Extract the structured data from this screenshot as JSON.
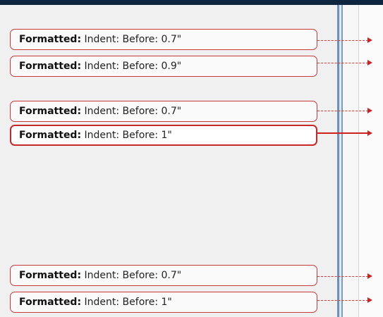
{
  "comments": [
    {
      "label": "Formatted:",
      "detail": " Indent: Before:  0.7\"",
      "selected": false
    },
    {
      "label": "Formatted:",
      "detail": " Indent: Before:  0.9\"",
      "selected": false
    },
    {
      "label": "Formatted:",
      "detail": " Indent: Before:  0.7\"",
      "selected": false
    },
    {
      "label": "Formatted:",
      "detail": " Indent: Before:  1\"",
      "selected": true
    },
    {
      "label": "Formatted:",
      "detail": " Indent: Before:  0.7\"",
      "selected": false
    },
    {
      "label": "Formatted:",
      "detail": " Indent: Before:  1\"",
      "selected": false
    }
  ],
  "colors": {
    "balloon_border": "#c83a3a",
    "connector": "#d23a3a",
    "pane_background": "#f0f0f0",
    "frame": "#0f2744"
  }
}
